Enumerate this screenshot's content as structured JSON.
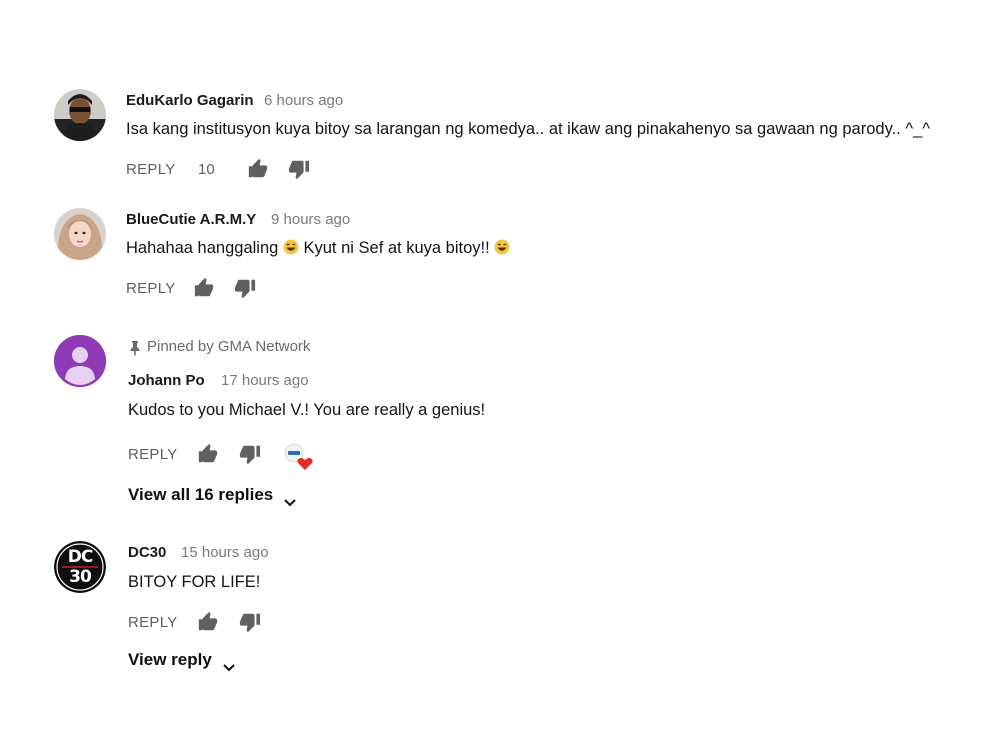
{
  "comments": [
    {
      "author": "EduKarlo Gagarin",
      "time": "6 hours ago",
      "text": "Isa kang institusyon kuya bitoy sa larangan ng komedya.. at ikaw ang pinakahenyo sa gawaan ng parody.. ^_^",
      "reply_label": "REPLY",
      "likes": "10"
    },
    {
      "author": "BlueCutie A.R.M.Y",
      "time": "9 hours ago",
      "text_part1": "Hahahaa hanggaling",
      "text_part2": "Kyut ni Sef at kuya bitoy!!",
      "reply_label": "REPLY"
    },
    {
      "pinned_label": "Pinned by GMA Network",
      "author": "Johann Po",
      "time": "17 hours ago",
      "text": "Kudos to you Michael V.! You are really a genius!",
      "reply_label": "REPLY",
      "view_replies": "View all 16 replies"
    },
    {
      "author": "DC30",
      "time": "15 hours ago",
      "text": "BITOY FOR LIFE!",
      "reply_label": "REPLY",
      "view_replies": "View reply",
      "avatar_text_top": "DC",
      "avatar_text_bottom": "30"
    }
  ],
  "colors": {
    "default_avatar_bg": "#8e3bb5",
    "heart": "#e52d27",
    "muted": "#606060"
  }
}
